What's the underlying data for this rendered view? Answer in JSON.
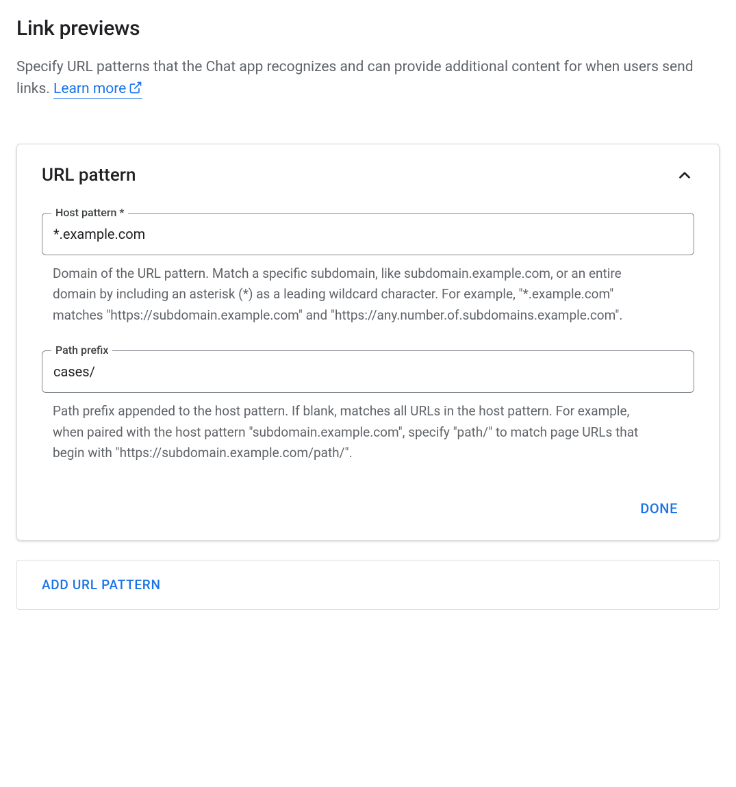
{
  "header": {
    "title": "Link previews",
    "description": "Specify URL patterns that the Chat app recognizes and can provide additional content for when users send links. ",
    "learn_more_label": "Learn more"
  },
  "card": {
    "title": "URL pattern",
    "host_pattern": {
      "label": "Host pattern *",
      "value": "*.example.com",
      "help": "Domain of the URL pattern. Match a specific subdomain, like subdomain.example.com, or an entire domain by including an asterisk (*) as a leading wildcard character. For example, \"*.example.com\" matches \"https://subdomain.example.com\" and \"https://any.number.of.subdomains.example.com\"."
    },
    "path_prefix": {
      "label": "Path prefix",
      "value": "cases/",
      "help": "Path prefix appended to the host pattern. If blank, matches all URLs in the host pattern. For example, when paired with the host pattern \"subdomain.example.com\", specify \"path/\" to match page URLs that begin with \"https://subdomain.example.com/path/\"."
    },
    "done_label": "DONE"
  },
  "add_button": {
    "label": "ADD URL PATTERN"
  }
}
